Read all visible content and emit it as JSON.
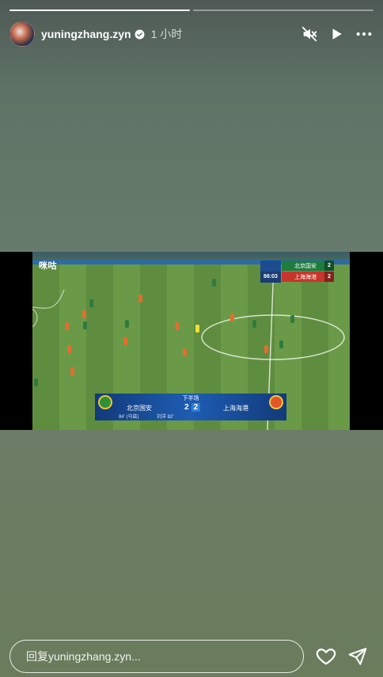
{
  "story": {
    "progress": [
      1.0,
      0.0
    ],
    "username": "yuningzhang.zyn",
    "verified": true,
    "time_ago": "1 小时"
  },
  "icons": {
    "mute": "speaker-muted-icon",
    "play": "play-icon",
    "more": "more-horizontal-icon",
    "verified": "verified-badge-icon",
    "like": "heart-icon",
    "share": "send-icon"
  },
  "video": {
    "broadcaster_logo": "咪咕",
    "scorebug": {
      "clock": "86:03",
      "home_team": "北京国安",
      "home_score": "2",
      "away_team": "上海海港",
      "away_score": "2"
    },
    "lower_third": {
      "period": "下半场",
      "home_team": "北京国安",
      "home_score": "2",
      "away_score": "2",
      "away_team": "上海海港",
      "scorer_home": "84' (乌兹)",
      "scorer_home_2": "刘洋 82'"
    }
  },
  "reply": {
    "placeholder": "回复yuningzhang.zyn..."
  },
  "colors": {
    "accent": "#ffffff",
    "home_team": "#1e7c3f",
    "away_team": "#c7362b"
  }
}
